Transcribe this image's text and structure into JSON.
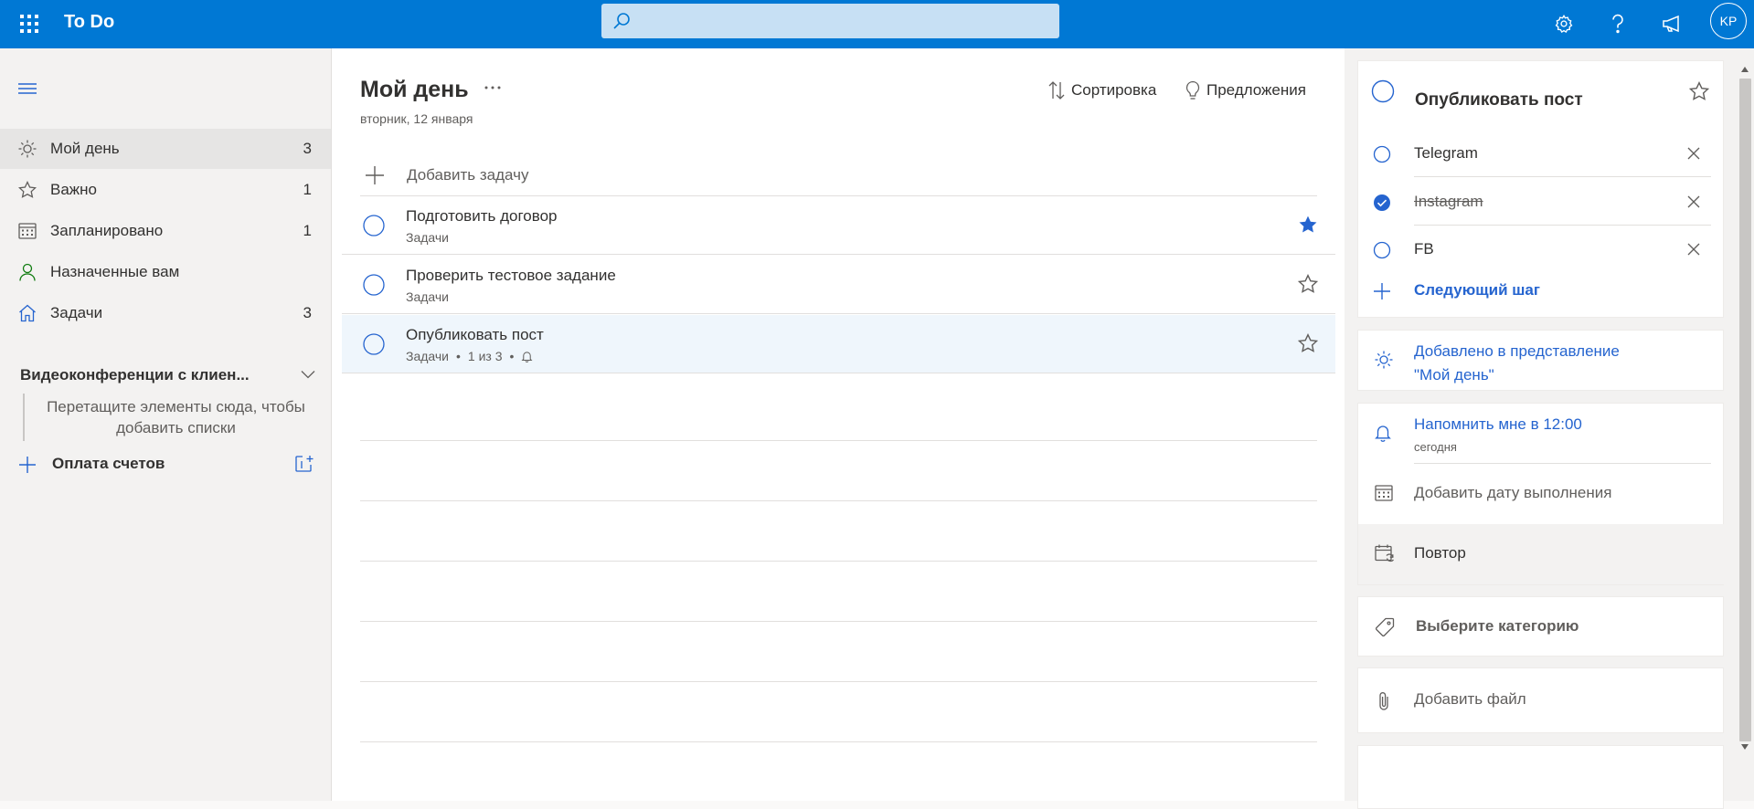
{
  "topbar": {
    "app_title": "To Do",
    "search_placeholder": "",
    "avatar_initials": "KP",
    "icons": [
      "app-launcher-icon",
      "search-icon",
      "gear-icon",
      "help-icon",
      "megaphone-icon"
    ]
  },
  "sidebar": {
    "items": [
      {
        "label": "Мой день",
        "count": "3",
        "icon": "sun-icon"
      },
      {
        "label": "Важно",
        "count": "1",
        "icon": "star-icon"
      },
      {
        "label": "Запланировано",
        "count": "1",
        "icon": "calendar-icon"
      },
      {
        "label": "Назначенные вам",
        "count": "",
        "icon": "person-icon"
      },
      {
        "label": "Задачи",
        "count": "3",
        "icon": "home-icon"
      }
    ],
    "group_title": "Видеоконференции с клиен...",
    "group_hint": "Перетащите элементы сюда, чтобы добавить списки",
    "new_list_label": "Оплата счетов"
  },
  "main": {
    "title": "Мой день",
    "subtitle": "вторник, 12 января",
    "sort_label": "Сортировка",
    "suggestions_label": "Предложения",
    "add_task_label": "Добавить задачу",
    "tasks": [
      {
        "title": "Подготовить договор",
        "list": "Задачи",
        "progress": "",
        "important": true
      },
      {
        "title": "Проверить тестовое задание",
        "list": "Задачи",
        "progress": "",
        "important": false
      },
      {
        "title": "Опубликовать пост",
        "list": "Задачи",
        "progress": "1 из 3",
        "important": false
      }
    ]
  },
  "details": {
    "task_title": "Опубликовать пост",
    "steps": [
      {
        "label": "Telegram",
        "done": false
      },
      {
        "label": "Instagram",
        "done": true
      },
      {
        "label": "FB",
        "done": false
      }
    ],
    "next_step_label": "Следующий шаг",
    "my_day_line1": "Добавлено в представление",
    "my_day_line2": "\"Мой день\"",
    "reminder_label": "Напомнить мне в 12:00",
    "reminder_sub": "сегодня",
    "due_date_label": "Добавить дату выполнения",
    "repeat_label": "Повтор",
    "category_label": "Выберите категорию",
    "file_label": "Добавить файл"
  },
  "colors": {
    "accent": "#0078d4",
    "link_blue": "#2564cf",
    "sidebar_bg": "#f3f2f1"
  }
}
